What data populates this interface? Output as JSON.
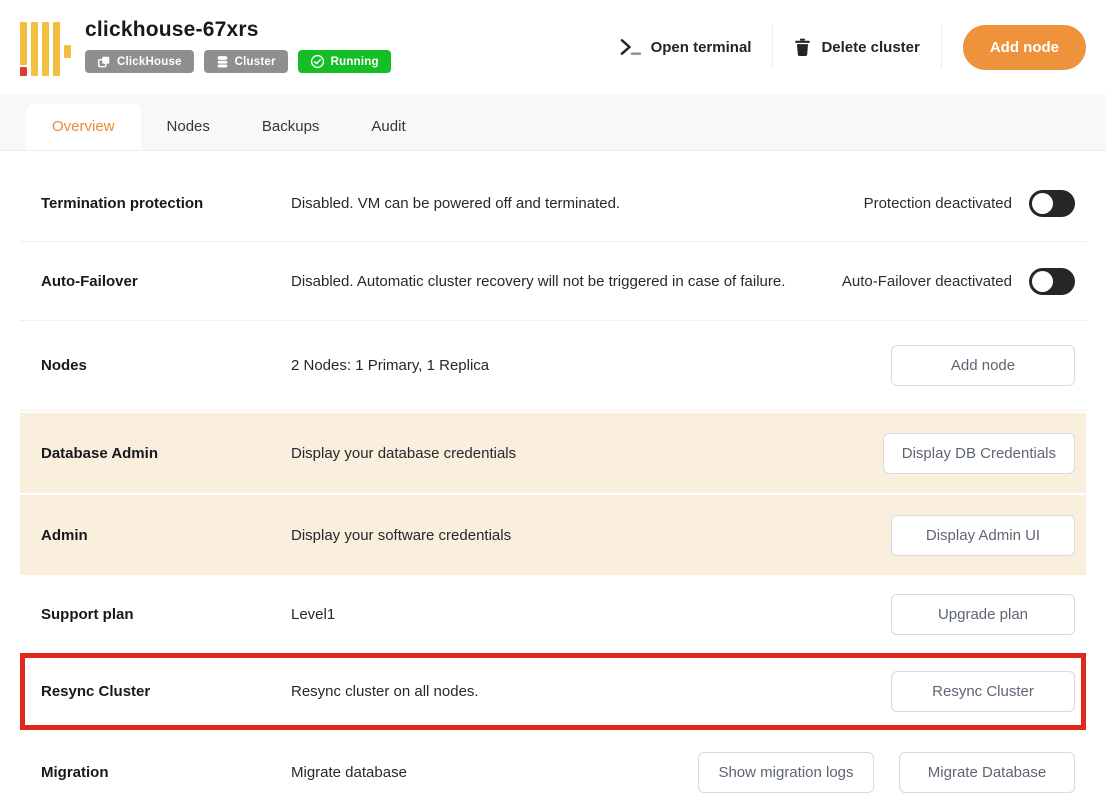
{
  "header": {
    "title": "clickhouse-67xrs",
    "badges": [
      {
        "label": "ClickHouse",
        "icon": "copy-stack-icon",
        "color": "#8F8F8F"
      },
      {
        "label": "Cluster",
        "icon": "database-icon",
        "color": "#8F8F8F"
      },
      {
        "label": "Running",
        "icon": "check-circle-icon",
        "color": "#16BE26"
      }
    ],
    "actions": {
      "open_terminal": "Open terminal",
      "delete_cluster": "Delete cluster",
      "add_node": "Add node"
    }
  },
  "tabs": [
    {
      "label": "Overview",
      "active": true
    },
    {
      "label": "Nodes",
      "active": false
    },
    {
      "label": "Backups",
      "active": false
    },
    {
      "label": "Audit",
      "active": false
    }
  ],
  "rows": [
    {
      "label": "Termination protection",
      "description": "Disabled. VM can be powered off and terminated.",
      "status_label": "Protection deactivated",
      "toggle": "off"
    },
    {
      "label": "Auto-Failover",
      "description": "Disabled. Automatic cluster recovery will not be triggered in case of failure.",
      "status_label": "Auto-Failover deactivated",
      "toggle": "off"
    },
    {
      "label": "Nodes",
      "description": "2 Nodes: 1 Primary, 1 Replica",
      "button": "Add node"
    },
    {
      "label": "Database Admin",
      "description": "Display your database credentials",
      "button": "Display DB Credentials",
      "highlighted": true
    },
    {
      "label": "Admin",
      "description": "Display your software credentials",
      "button": "Display Admin UI",
      "highlighted": true
    },
    {
      "label": "Support plan",
      "description": "Level1",
      "button": "Upgrade plan"
    },
    {
      "label": "Resync Cluster",
      "description": "Resync cluster on all nodes.",
      "button": "Resync Cluster",
      "annotated_red_box": true
    },
    {
      "label": "Migration",
      "description": "Migrate database",
      "buttons": [
        "Show migration logs",
        "Migrate Database"
      ]
    }
  ],
  "colors": {
    "accent_orange": "#EF923C",
    "active_tab_text": "#ED8C33",
    "running_green": "#16BE26",
    "badge_gray": "#8F8F8F",
    "highlight_beige": "#FAEEDC",
    "annotation_red": "#E0281C",
    "logo_yellow": "#F4BE41",
    "logo_red": "#E03A2E",
    "toggle_off_bg": "#262626"
  }
}
